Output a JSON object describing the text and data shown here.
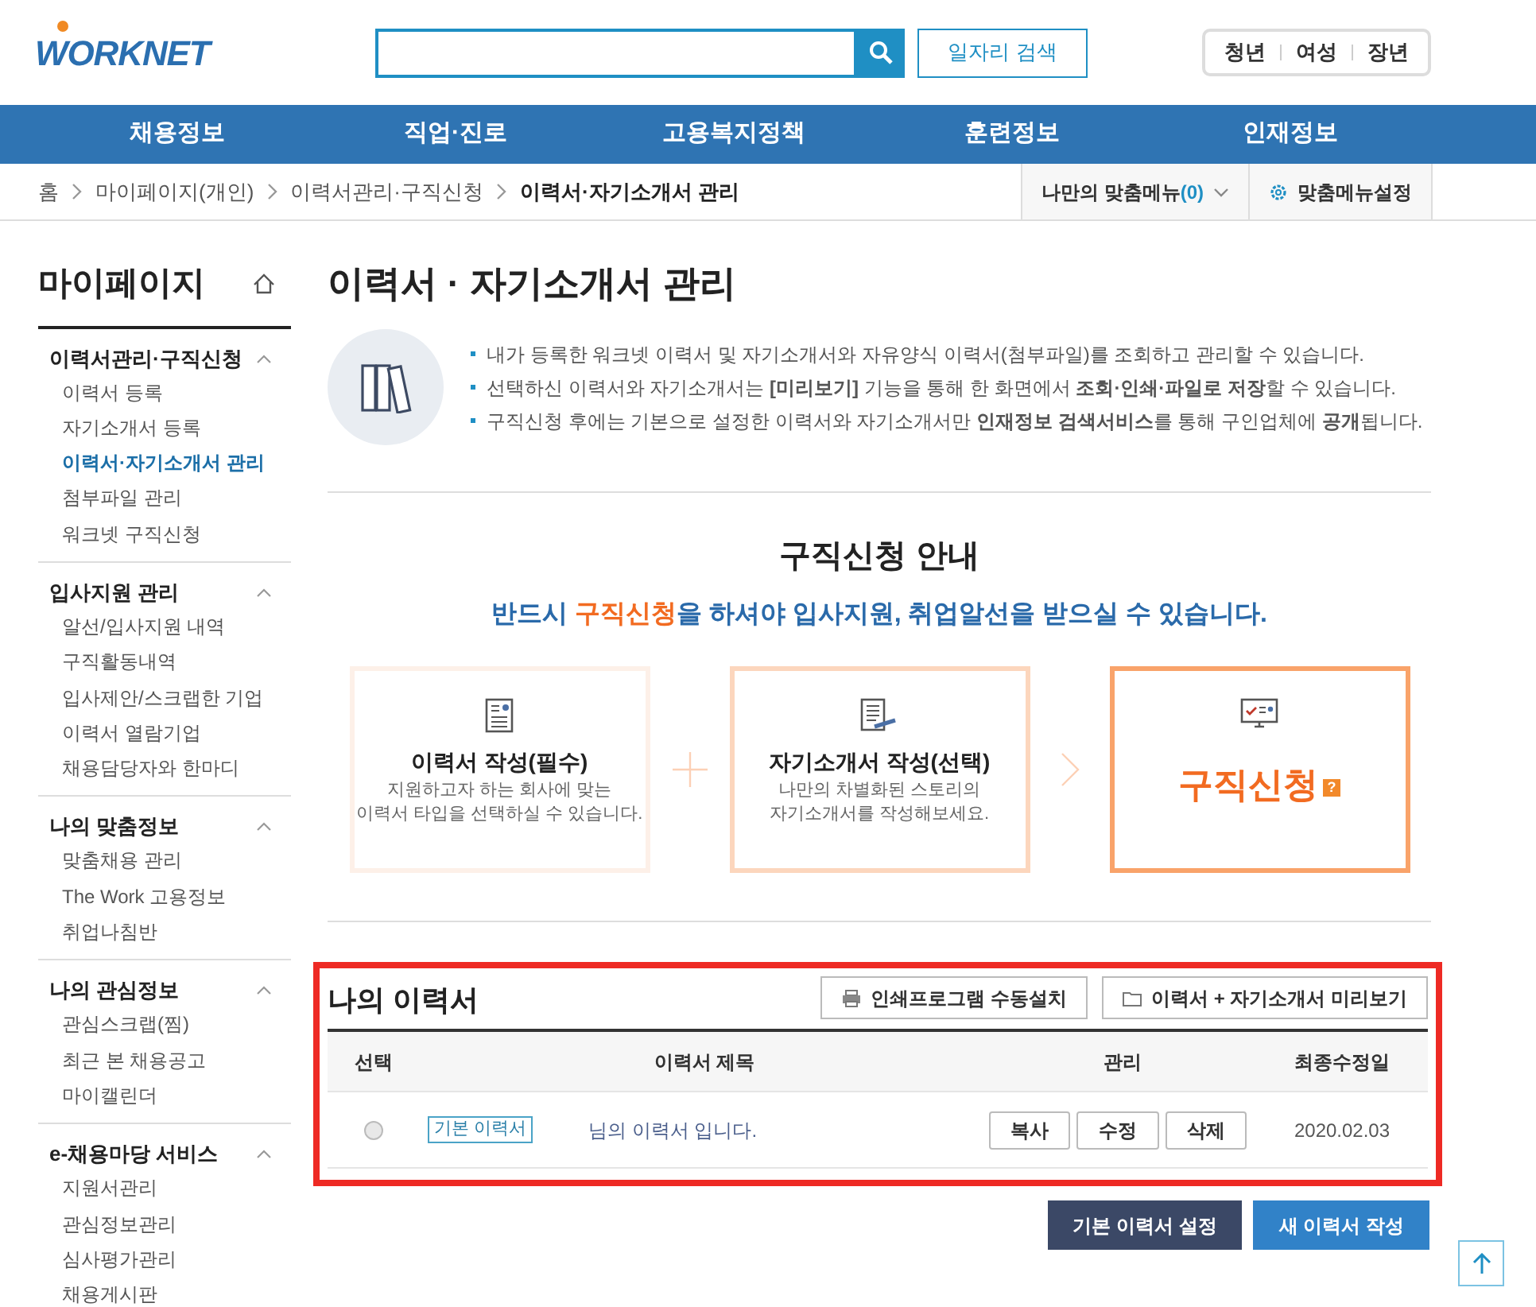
{
  "header": {
    "logo": "WORKNET",
    "job_search_button": "일자리 검색",
    "audience_links": [
      "청년",
      "여성",
      "장년"
    ]
  },
  "nav": [
    "채용정보",
    "직업·진로",
    "고용복지정책",
    "훈련정보",
    "인재정보"
  ],
  "breadcrumb": {
    "items": [
      "홈",
      "마이페이지(개인)",
      "이력서관리·구직신청",
      "이력서·자기소개서 관리"
    ],
    "my_menu": "나만의 맞춤메뉴",
    "my_menu_count": "(0)",
    "menu_settings": "맞춤메뉴설정"
  },
  "sidebar": {
    "title": "마이페이지",
    "groups": [
      {
        "title": "이력서관리·구직신청",
        "expanded": true,
        "items": [
          {
            "label": "이력서 등록",
            "selected": false
          },
          {
            "label": "자기소개서 등록",
            "selected": false
          },
          {
            "label": "이력서·자기소개서 관리",
            "selected": true
          },
          {
            "label": "첨부파일 관리",
            "selected": false
          },
          {
            "label": "워크넷 구직신청",
            "selected": false
          }
        ]
      },
      {
        "title": "입사지원 관리",
        "expanded": true,
        "items": [
          {
            "label": "알선/입사지원 내역",
            "selected": false
          },
          {
            "label": "구직활동내역",
            "selected": false
          },
          {
            "label": "입사제안/스크랩한 기업",
            "selected": false
          },
          {
            "label": "이력서 열람기업",
            "selected": false
          },
          {
            "label": "채용담당자와 한마디",
            "selected": false
          }
        ]
      },
      {
        "title": "나의 맞춤정보",
        "expanded": true,
        "items": [
          {
            "label": "맞춤채용 관리",
            "selected": false
          },
          {
            "label": "The Work 고용정보",
            "selected": false
          },
          {
            "label": "취업나침반",
            "selected": false
          }
        ]
      },
      {
        "title": "나의 관심정보",
        "expanded": true,
        "items": [
          {
            "label": "관심스크랩(찜)",
            "selected": false
          },
          {
            "label": "최근 본 채용공고",
            "selected": false
          },
          {
            "label": "마이캘린더",
            "selected": false
          }
        ]
      },
      {
        "title": "e-채용마당 서비스",
        "expanded": true,
        "items": [
          {
            "label": "지원서관리",
            "selected": false
          },
          {
            "label": "관심정보관리",
            "selected": false
          },
          {
            "label": "심사평가관리",
            "selected": false
          },
          {
            "label": "채용게시판",
            "selected": false
          }
        ]
      }
    ]
  },
  "page_title": "이력서 · 자기소개서 관리",
  "info_lines": [
    "내가 등록한 워크넷 이력서 및 자기소개서와 자유양식 이력서(첨부파일)를 조회하고 관리할 수 있습니다.",
    "선택하신 이력서와 자기소개서는 **[미리보기]** 기능을 통해 한 화면에서 **조회·인쇄·파일로 저장**할 수 있습니다.",
    "구직신청 후에는 기본으로 설정한 이력서와 자기소개서만 **인재정보 검색서비스**를 통해 구인업체에 **공개**됩니다."
  ],
  "guide": {
    "title": "구직신청 안내",
    "subtitle": {
      "before": "반드시 ",
      "highlight": "구직신청",
      "after": "을 하셔야 입사지원, 취업알선을 받으실 수 있습니다."
    },
    "steps": [
      {
        "kind": "step",
        "title": "이력서 작성(필수)",
        "description": [
          "지원하고자 하는 회사에 맞는",
          "이력서 타입을 선택하실 수 있습니다."
        ]
      },
      {
        "kind": "step",
        "title": "자기소개서 작성(선택)",
        "description": [
          "나만의 차별화된 스토리의",
          "자기소개서를 작성해보세요."
        ]
      },
      {
        "kind": "apply",
        "title": "구직신청",
        "badge": "?"
      }
    ]
  },
  "resumes": {
    "title": "나의 이력서",
    "buttons": [
      "인쇄프로그램 수동설치",
      "이력서 + 자기소개서 미리보기"
    ],
    "columns": [
      "선택",
      "이력서 제목",
      "관리",
      "최종수정일"
    ],
    "rows": [
      {
        "selected": false,
        "tag": "기본 이력서",
        "title": "님의 이력서 입니다.",
        "actions": [
          "복사",
          "수정",
          "삭제"
        ],
        "date": "2020.02.03"
      }
    ],
    "footer_buttons": [
      {
        "kind": "dark",
        "label": "기본 이력서 설정"
      },
      {
        "kind": "primary",
        "label": "새 이력서 작성"
      }
    ]
  }
}
